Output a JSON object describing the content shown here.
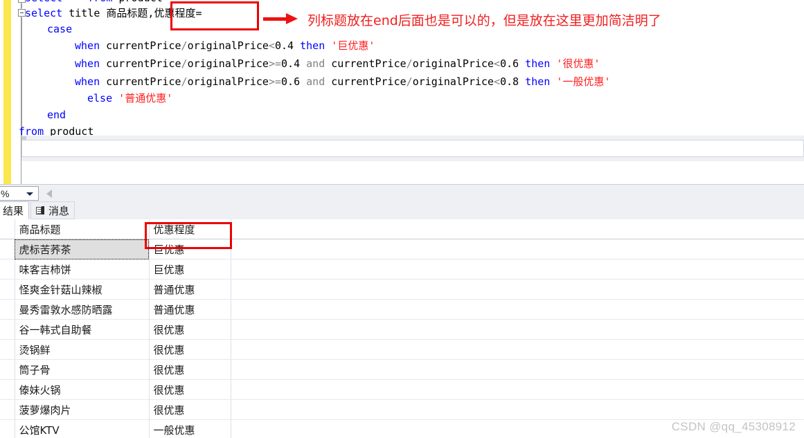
{
  "editor": {
    "lines": [
      {
        "id": "line-0-partial",
        "segments": [
          {
            "t": "select",
            "cls": "kw"
          },
          {
            "t": "  * ",
            "cls": "op"
          },
          {
            "t": "from",
            "cls": "kw"
          },
          {
            "t": " product",
            "cls": "plain"
          }
        ],
        "indent": 0,
        "truncated_top": true
      },
      {
        "id": "line-1",
        "segments": [
          {
            "t": "select",
            "cls": "kw"
          },
          {
            "t": " title ",
            "cls": "plain"
          },
          {
            "t": "商品标题",
            "cls": "cjk"
          },
          {
            "t": ",",
            "cls": "plain"
          },
          {
            "t": "优惠程度",
            "cls": "cjk"
          },
          {
            "t": "=",
            "cls": "plain"
          }
        ]
      },
      {
        "id": "line-2",
        "segments": [
          {
            "t": "case",
            "cls": "kw"
          }
        ]
      },
      {
        "id": "line-3",
        "segments": [
          {
            "t": "when",
            "cls": "kw"
          },
          {
            "t": " currentPrice",
            "cls": "plain"
          },
          {
            "t": "/",
            "cls": "op"
          },
          {
            "t": "originalPrice",
            "cls": "plain"
          },
          {
            "t": "<",
            "cls": "op"
          },
          {
            "t": "0.4 ",
            "cls": "plain"
          },
          {
            "t": "then",
            "cls": "kw"
          },
          {
            "t": " ",
            "cls": "plain"
          },
          {
            "t": "'巨优惠'",
            "cls": "str"
          }
        ]
      },
      {
        "id": "line-4",
        "segments": [
          {
            "t": "when",
            "cls": "kw"
          },
          {
            "t": " currentPrice",
            "cls": "plain"
          },
          {
            "t": "/",
            "cls": "op"
          },
          {
            "t": "originalPrice",
            "cls": "plain"
          },
          {
            "t": ">=",
            "cls": "op"
          },
          {
            "t": "0.4 ",
            "cls": "plain"
          },
          {
            "t": "and",
            "cls": "op"
          },
          {
            "t": " currentPrice",
            "cls": "plain"
          },
          {
            "t": "/",
            "cls": "op"
          },
          {
            "t": "originalPrice",
            "cls": "plain"
          },
          {
            "t": "<",
            "cls": "op"
          },
          {
            "t": "0.6 ",
            "cls": "plain"
          },
          {
            "t": "then",
            "cls": "kw"
          },
          {
            "t": " ",
            "cls": "plain"
          },
          {
            "t": "'很优惠'",
            "cls": "str"
          }
        ]
      },
      {
        "id": "line-5",
        "segments": [
          {
            "t": "when",
            "cls": "kw"
          },
          {
            "t": " currentPrice",
            "cls": "plain"
          },
          {
            "t": "/",
            "cls": "op"
          },
          {
            "t": "originalPrice",
            "cls": "plain"
          },
          {
            "t": ">=",
            "cls": "op"
          },
          {
            "t": "0.6 ",
            "cls": "plain"
          },
          {
            "t": "and",
            "cls": "op"
          },
          {
            "t": " currentPrice",
            "cls": "plain"
          },
          {
            "t": "/",
            "cls": "op"
          },
          {
            "t": "originalPrice",
            "cls": "plain"
          },
          {
            "t": "<",
            "cls": "op"
          },
          {
            "t": "0.8 ",
            "cls": "plain"
          },
          {
            "t": "then",
            "cls": "kw"
          },
          {
            "t": " ",
            "cls": "plain"
          },
          {
            "t": "'一般优惠'",
            "cls": "str"
          }
        ]
      },
      {
        "id": "line-6",
        "segments": [
          {
            "t": "else",
            "cls": "kw"
          },
          {
            "t": " ",
            "cls": "plain"
          },
          {
            "t": "'普通优惠'",
            "cls": "str"
          }
        ]
      },
      {
        "id": "line-7",
        "segments": [
          {
            "t": "end",
            "cls": "kw"
          }
        ]
      },
      {
        "id": "line-8",
        "segments": [
          {
            "t": "from",
            "cls": "kw"
          },
          {
            "t": " product",
            "cls": "plain"
          }
        ]
      }
    ]
  },
  "annotation": {
    "arrow_name": "red-arrow",
    "text": "列标题放在end后面也是可以的，但是放在这里更加简洁明了",
    "color": "#f01e1e",
    "highlight_box_color": "#ee0000",
    "boxed_code_fragment": "优惠程度=",
    "boxed_grid_column": "优惠程度"
  },
  "zoom_bar": {
    "zoom_value": "%",
    "caret_icon": "chevron-down-icon",
    "scroll_icon": "scroll-left-arrow-icon"
  },
  "result_tabs": [
    {
      "label": "结果",
      "active": true,
      "icon": null
    },
    {
      "label": "消息",
      "active": false,
      "icon": "message-document-icon"
    }
  ],
  "grid": {
    "columns": [
      "",
      "商品标题",
      "优惠程度",
      ""
    ],
    "rows": [
      {
        "title": "虎标苦荞茶",
        "level": "巨优惠",
        "selected": true
      },
      {
        "title": "味客吉柿饼",
        "level": "巨优惠",
        "selected": false
      },
      {
        "title": "怪爽金针菇山辣椒",
        "level": "普通优惠",
        "selected": false
      },
      {
        "title": "曼秀雷敦水感防晒露",
        "level": "普通优惠",
        "selected": false
      },
      {
        "title": "谷一韩式自助餐",
        "level": "很优惠",
        "selected": false
      },
      {
        "title": "烫锅鲜",
        "level": "很优惠",
        "selected": false
      },
      {
        "title": "筒子骨",
        "level": "很优惠",
        "selected": false
      },
      {
        "title": "傣妹火锅",
        "level": "很优惠",
        "selected": false
      },
      {
        "title": "菠萝爆肉片",
        "level": "很优惠",
        "selected": false
      },
      {
        "title": "公馆KTV",
        "level": "一般优惠",
        "selected": false
      }
    ]
  },
  "watermark": "CSDN @qq_45308912"
}
